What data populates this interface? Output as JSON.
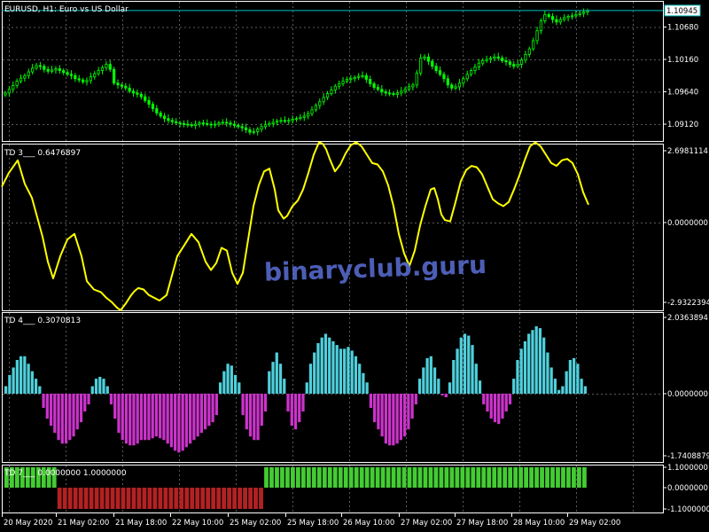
{
  "chart_data": [
    {
      "type": "candlestick",
      "title": "EURUSD, H1:  Euro vs US Dollar",
      "color": "#00ff00",
      "y_ticks": [
        "1.10680",
        "1.10160",
        "1.09640",
        "1.09120"
      ],
      "y_tick_values": [
        1.1068,
        1.1016,
        1.0964,
        1.0912
      ],
      "ylim": [
        1.0885,
        1.111
      ],
      "current_price": "1.10945",
      "current_price_value": 1.10945,
      "close_series": [
        1.0962,
        1.0968,
        1.0974,
        1.0981,
        1.0986,
        1.099,
        1.0996,
        1.1002,
        1.1006,
        1.1005,
        1.1,
        1.0997,
        1.0999,
        1.1001,
        1.0998,
        1.0995,
        1.0992,
        1.099,
        1.0985,
        1.0983,
        1.098,
        1.0982,
        1.0988,
        1.0993,
        1.0998,
        1.1003,
        1.1008,
        1.1,
        1.0978,
        1.0975,
        1.0973,
        1.097,
        1.0965,
        1.0962,
        1.096,
        1.0956,
        1.095,
        1.0944,
        1.0937,
        1.093,
        1.0925,
        1.0921,
        1.0918,
        1.0916,
        1.0914,
        1.0913,
        1.0912,
        1.0911,
        1.091,
        1.0912,
        1.0914,
        1.0913,
        1.0912,
        1.0911,
        1.0912,
        1.0914,
        1.0915,
        1.0914,
        1.0912,
        1.091,
        1.0908,
        1.0906,
        1.0903,
        1.0899,
        1.09,
        1.0904,
        1.0908,
        1.0911,
        1.0913,
        1.0915,
        1.0917,
        1.0918,
        1.0917,
        1.0918,
        1.092,
        1.0921,
        1.0923,
        1.0925,
        1.0929,
        1.0935,
        1.0942,
        1.0948,
        1.0955,
        1.0961,
        1.0967,
        1.0973,
        1.0977,
        1.0981,
        1.0984,
        1.0985,
        1.0987,
        1.0989,
        1.099,
        1.0984,
        1.0977,
        1.0971,
        1.0968,
        1.0964,
        1.0962,
        1.0961,
        1.096,
        1.0962,
        1.0965,
        1.0968,
        1.0972,
        1.0975,
        1.0994,
        1.1018,
        1.102,
        1.1013,
        1.1005,
        1.0998,
        1.0992,
        1.0985,
        1.0975,
        1.097,
        1.0972,
        1.0978,
        1.0985,
        1.0992,
        1.0998,
        1.1004,
        1.101,
        1.1014,
        1.1016,
        1.1018,
        1.102,
        1.1018,
        1.1014,
        1.1012,
        1.1008,
        1.1005,
        1.1008,
        1.1015,
        1.1024,
        1.1033,
        1.1046,
        1.1062,
        1.1078,
        1.1088,
        1.1085,
        1.108,
        1.1076,
        1.108,
        1.1083,
        1.1085,
        1.1086,
        1.1088,
        1.109,
        1.1092,
        1.1094
      ]
    },
    {
      "type": "line",
      "label": "TD 3___  0.6476897",
      "color": "#ffff00",
      "y_ticks": [
        "2.6981114",
        "0.0000000",
        "-2.9322394"
      ],
      "y_tick_values": [
        2.6981114,
        0.0,
        -2.9322394
      ],
      "ylim": [
        -3.05,
        2.95
      ],
      "x": [
        0,
        8,
        18,
        26,
        34,
        40,
        46,
        52,
        58,
        66,
        74,
        82,
        90,
        96,
        104,
        112,
        118,
        124,
        130,
        134,
        140,
        146,
        150,
        154,
        160,
        166,
        172,
        178,
        186,
        192,
        198,
        206,
        214,
        222,
        230,
        236,
        242,
        248,
        254,
        260,
        266,
        272,
        278,
        284,
        290,
        296,
        302,
        308,
        312,
        318,
        322,
        328,
        334,
        340,
        346,
        352,
        358,
        362,
        366,
        370,
        376,
        382,
        388,
        394,
        400,
        406,
        412,
        418,
        424,
        430,
        436,
        442,
        448,
        454,
        460,
        466,
        472,
        478,
        484,
        488,
        492,
        496,
        500,
        506,
        512,
        518,
        524,
        530,
        536,
        542,
        548,
        554,
        560,
        566,
        572,
        578,
        584,
        590,
        596,
        602,
        608,
        614,
        620,
        626,
        632,
        638,
        644,
        650,
        656,
        662
      ],
      "values": [
        1.4,
        1.9,
        2.35,
        1.5,
        1.0,
        0.3,
        -0.4,
        -1.3,
        -1.9,
        -1.1,
        -0.5,
        -0.3,
        -1.1,
        -2.0,
        -2.3,
        -2.4,
        -2.6,
        -2.75,
        -2.95,
        -3.05,
        -2.8,
        -2.5,
        -2.35,
        -2.25,
        -2.3,
        -2.5,
        -2.6,
        -2.7,
        -2.5,
        -1.8,
        -1.1,
        -0.7,
        -0.3,
        -0.6,
        -1.3,
        -1.6,
        -1.35,
        -0.8,
        -0.9,
        -1.7,
        -2.1,
        -1.7,
        -0.5,
        0.7,
        1.45,
        1.95,
        2.05,
        1.3,
        0.55,
        0.25,
        0.35,
        0.7,
        0.9,
        1.3,
        1.9,
        2.55,
        3.0,
        2.95,
        2.75,
        2.4,
        1.95,
        2.2,
        2.6,
        2.9,
        3.0,
        2.85,
        2.55,
        2.25,
        2.2,
        1.95,
        1.45,
        0.7,
        -0.3,
        -1.0,
        -1.45,
        -0.9,
        0.0,
        0.7,
        1.3,
        1.35,
        0.95,
        0.4,
        0.2,
        0.15,
        0.85,
        1.6,
        2.0,
        2.15,
        2.1,
        1.85,
        1.4,
        0.95,
        0.8,
        0.7,
        0.85,
        1.3,
        1.8,
        2.35,
        2.85,
        3.0,
        2.85,
        2.55,
        2.25,
        2.15,
        2.35,
        2.4,
        2.25,
        1.85,
        1.2,
        0.75
      ]
    },
    {
      "type": "bar",
      "label": "TD 4___  0.3070813",
      "positive_color": "#4fd0dc",
      "negative_color": "#cc33cc",
      "y_ticks": [
        "2.0363894",
        "0.0000000",
        "-1.7408879"
      ],
      "y_tick_values": [
        2.0363894,
        0.0,
        -1.7408879
      ],
      "ylim": [
        -1.7408879,
        2.0363894
      ],
      "values": [
        0.2,
        0.5,
        0.7,
        0.9,
        1.0,
        1.0,
        0.8,
        0.6,
        0.4,
        0.2,
        -0.4,
        -0.7,
        -0.9,
        -1.1,
        -1.3,
        -1.4,
        -1.4,
        -1.3,
        -1.2,
        -1.0,
        -0.8,
        -0.5,
        -0.3,
        0.2,
        0.4,
        0.45,
        0.4,
        0.2,
        -0.3,
        -0.7,
        -1.1,
        -1.3,
        -1.4,
        -1.45,
        -1.45,
        -1.4,
        -1.3,
        -1.3,
        -1.3,
        -1.25,
        -1.2,
        -1.25,
        -1.3,
        -1.4,
        -1.5,
        -1.6,
        -1.65,
        -1.6,
        -1.5,
        -1.4,
        -1.3,
        -1.2,
        -1.1,
        -1.0,
        -0.9,
        -0.8,
        -0.6,
        0.3,
        0.6,
        0.8,
        0.75,
        0.5,
        0.3,
        -0.6,
        -1.0,
        -1.2,
        -1.3,
        -1.3,
        -0.9,
        -0.5,
        0.6,
        0.85,
        1.1,
        0.8,
        0.4,
        -0.5,
        -0.9,
        -1.0,
        -0.8,
        -0.5,
        0.3,
        0.8,
        1.1,
        1.35,
        1.5,
        1.6,
        1.5,
        1.4,
        1.3,
        1.2,
        1.2,
        1.25,
        1.15,
        1.0,
        0.8,
        0.55,
        0.3,
        -0.4,
        -0.8,
        -1.0,
        -1.2,
        -1.4,
        -1.45,
        -1.45,
        -1.4,
        -1.3,
        -1.2,
        -1.0,
        -0.7,
        -0.3,
        0.4,
        0.7,
        0.95,
        1.0,
        0.7,
        0.4,
        -0.05,
        -0.1,
        0.3,
        0.9,
        1.2,
        1.5,
        1.6,
        1.55,
        1.3,
        0.8,
        0.35,
        -0.3,
        -0.5,
        -0.7,
        -0.8,
        -0.85,
        -0.7,
        -0.5,
        -0.3,
        0.4,
        0.9,
        1.2,
        1.4,
        1.6,
        1.7,
        1.8,
        1.75,
        1.5,
        1.1,
        0.7,
        0.4,
        0.1,
        0.2,
        0.6,
        0.9,
        0.95,
        0.8,
        0.4,
        0.2
      ]
    },
    {
      "type": "bar",
      "label": "TD 7___  0.0000000  1.0000000",
      "positive_color": "#44cc33",
      "negative_color": "#b22222",
      "y_ticks": [
        "1.1000000",
        "0.0000000",
        "-1.1000000"
      ],
      "y_tick_values": [
        1.1,
        0.0,
        -1.1
      ],
      "ylim": [
        -1.1,
        1.1
      ],
      "segments": [
        {
          "from": 0,
          "to": 10,
          "value": 1
        },
        {
          "from": 10,
          "to": 49,
          "value": -1
        },
        {
          "from": 49,
          "to": 110,
          "value": 1
        }
      ],
      "bar_count": 110
    }
  ],
  "x_ticks": [
    "20 May 2020",
    "21 May 02:00",
    "21 May 18:00",
    "22 May 10:00",
    "25 May 02:00",
    "25 May 18:00",
    "26 May 10:00",
    "27 May 02:00",
    "27 May 18:00",
    "28 May 10:00",
    "29 May 02:00"
  ],
  "watermark": "binaryclub.guru"
}
